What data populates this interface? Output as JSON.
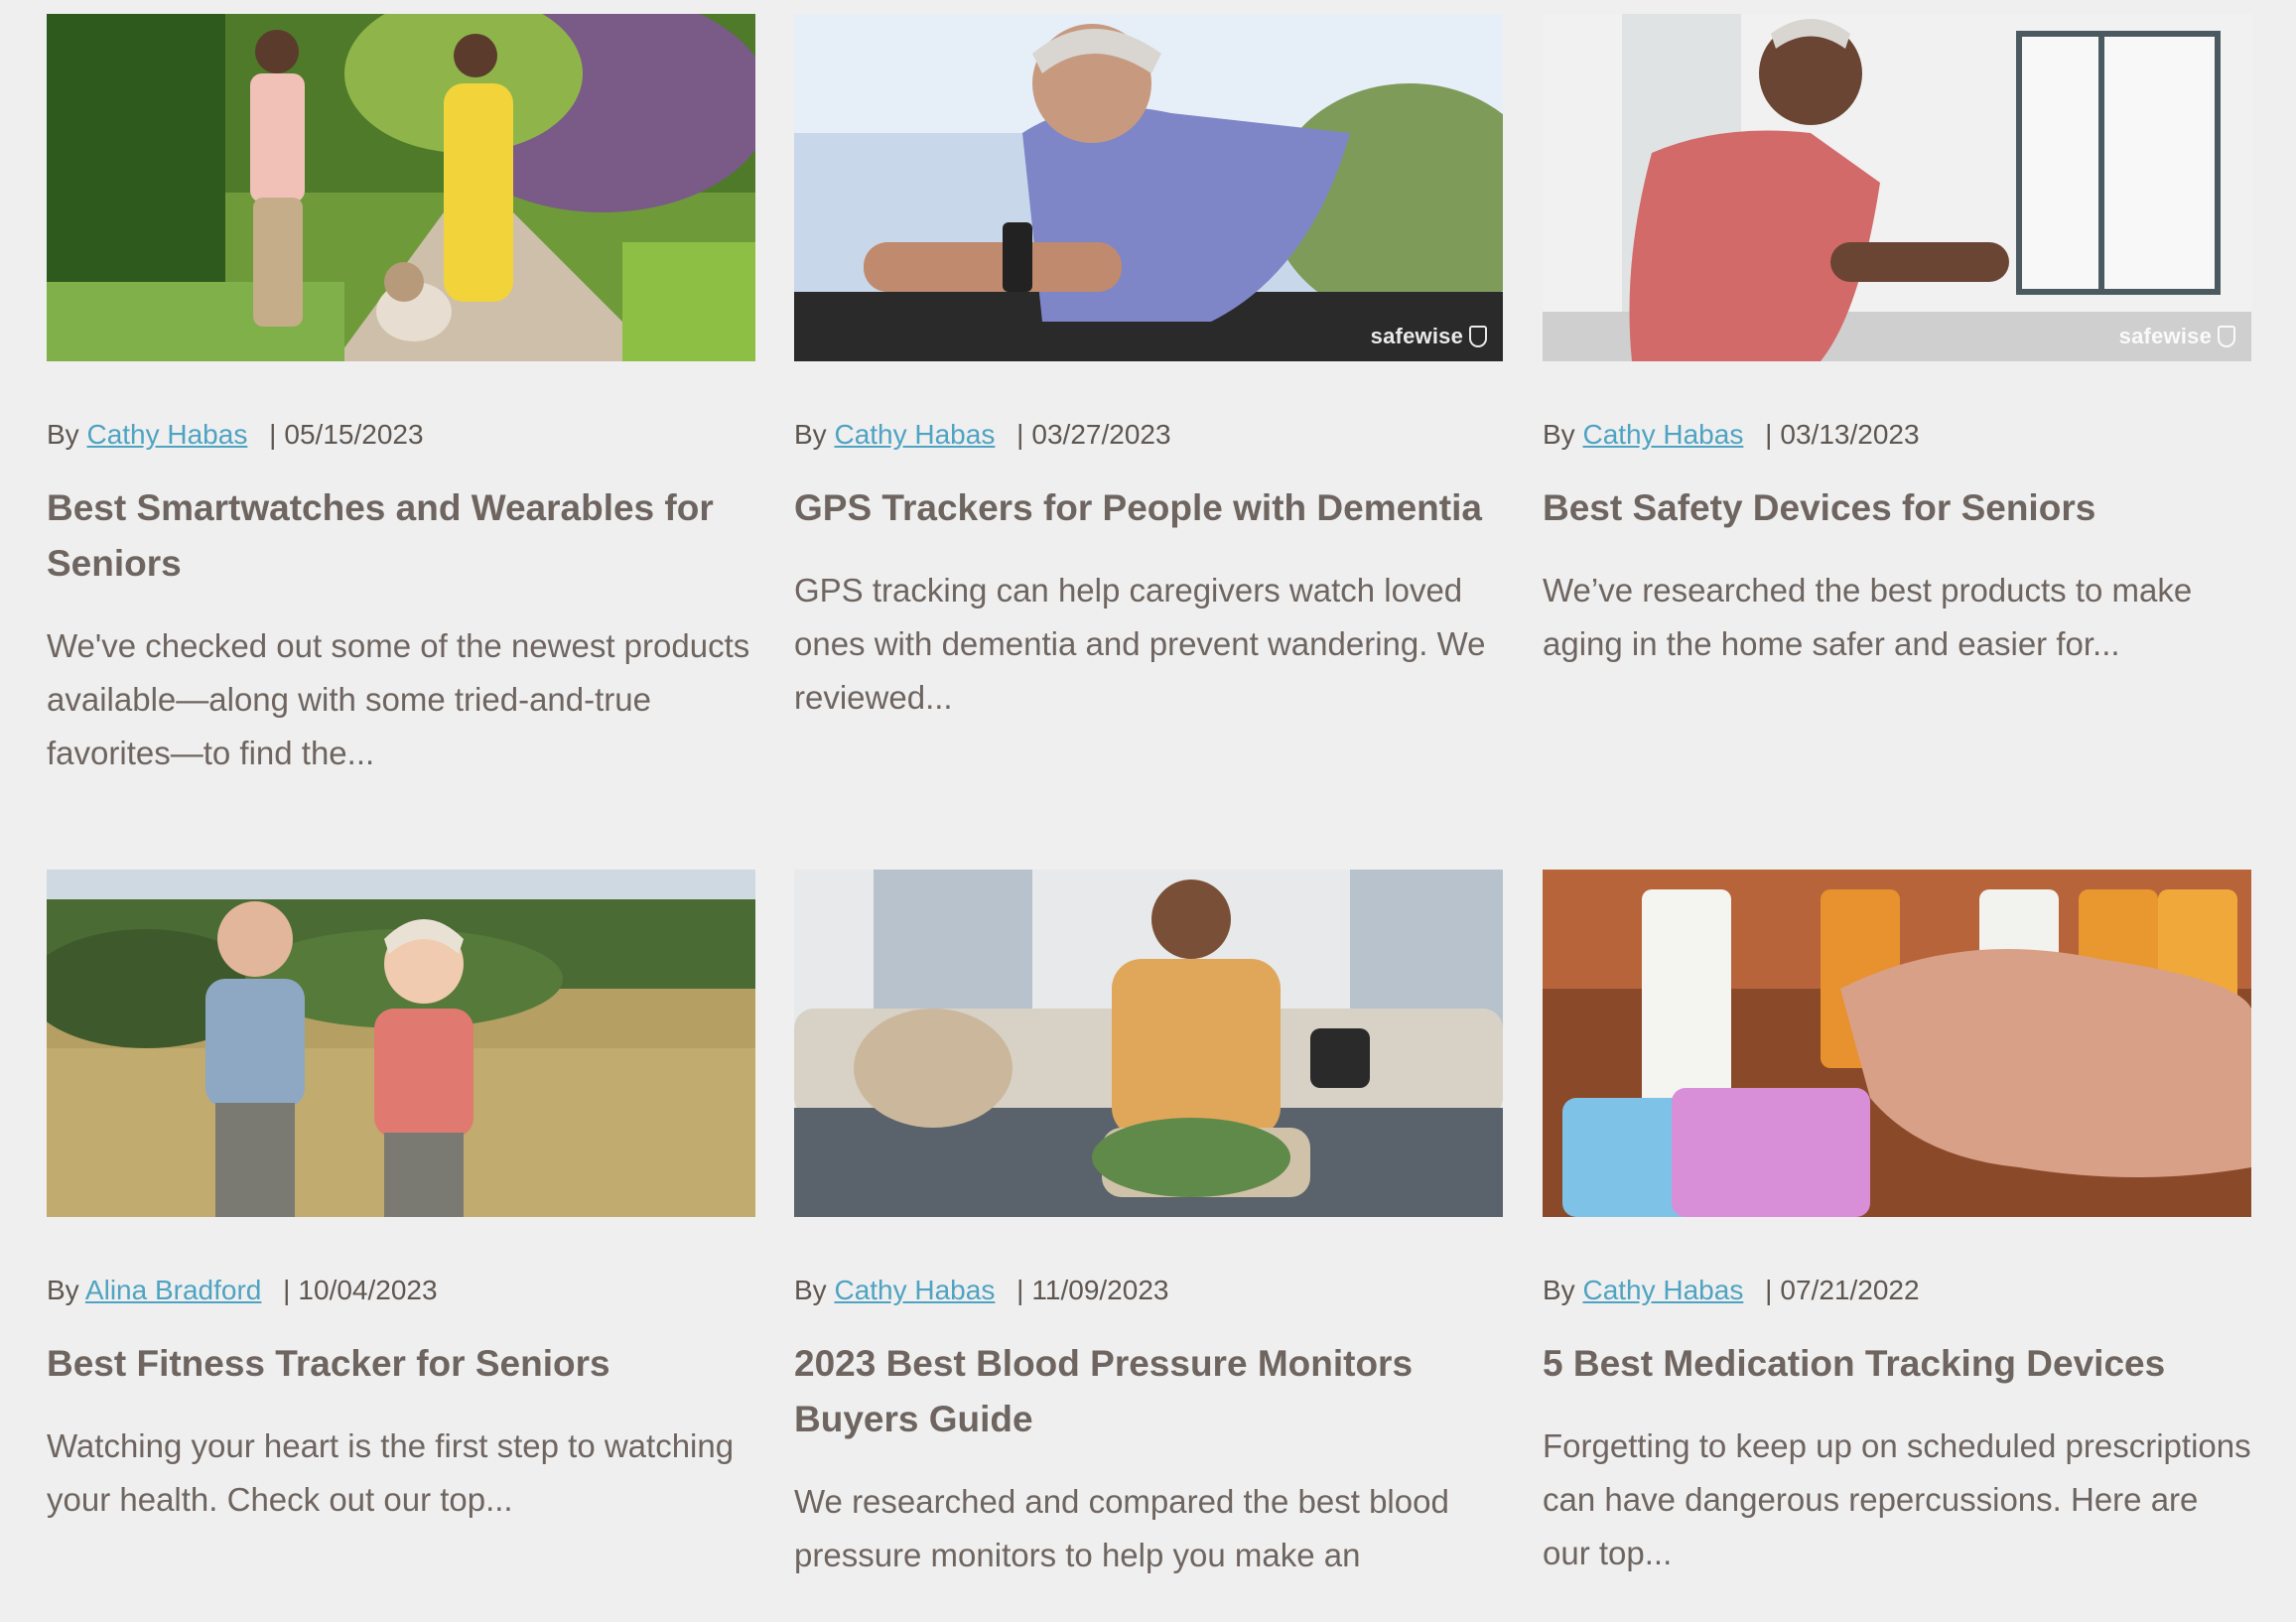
{
  "articles": [
    {
      "author_prefix": "By",
      "author": "Cathy Habas",
      "separator": "|",
      "date": "05/15/2023",
      "title": "Best Smartwatches and Wearables for Seniors",
      "excerpt": "We've checked out some of the newest products available—along with some tried-and-true favorites—to find the...",
      "image_watermark": ""
    },
    {
      "author_prefix": "By",
      "author": "Cathy Habas",
      "separator": "|",
      "date": "03/27/2023",
      "title": "GPS Trackers for People with Dementia",
      "excerpt": "GPS tracking can help caregivers watch loved ones with dementia and prevent wandering. We reviewed...",
      "image_watermark": "safewise"
    },
    {
      "author_prefix": "By",
      "author": "Cathy Habas",
      "separator": "|",
      "date": "03/13/2023",
      "title": "Best Safety Devices for Seniors",
      "excerpt": "We’ve researched the best products to make aging in the home safer and easier for...",
      "image_watermark": "safewise"
    },
    {
      "author_prefix": "By",
      "author": "Alina Bradford",
      "separator": "|",
      "date": "10/04/2023",
      "title": "Best Fitness Tracker for Seniors",
      "excerpt": "Watching your heart is the first step to watching your health. Check out our top...",
      "image_watermark": ""
    },
    {
      "author_prefix": "By",
      "author": "Cathy Habas",
      "separator": "|",
      "date": "11/09/2023",
      "title": "2023 Best Blood Pressure Monitors Buyers Guide",
      "excerpt": "We researched and compared the best blood pressure monitors to help you make an",
      "image_watermark": ""
    },
    {
      "author_prefix": "By",
      "author": "Cathy Habas",
      "separator": "|",
      "date": "07/21/2022",
      "title": "5 Best Medication Tracking Devices",
      "excerpt": "Forgetting to keep up on scheduled prescriptions can have dangerous repercussions. Here are our top...",
      "image_watermark": ""
    }
  ],
  "colors": {
    "background": "#efefef",
    "link": "#4fa3c2",
    "text": "#6e6560"
  }
}
